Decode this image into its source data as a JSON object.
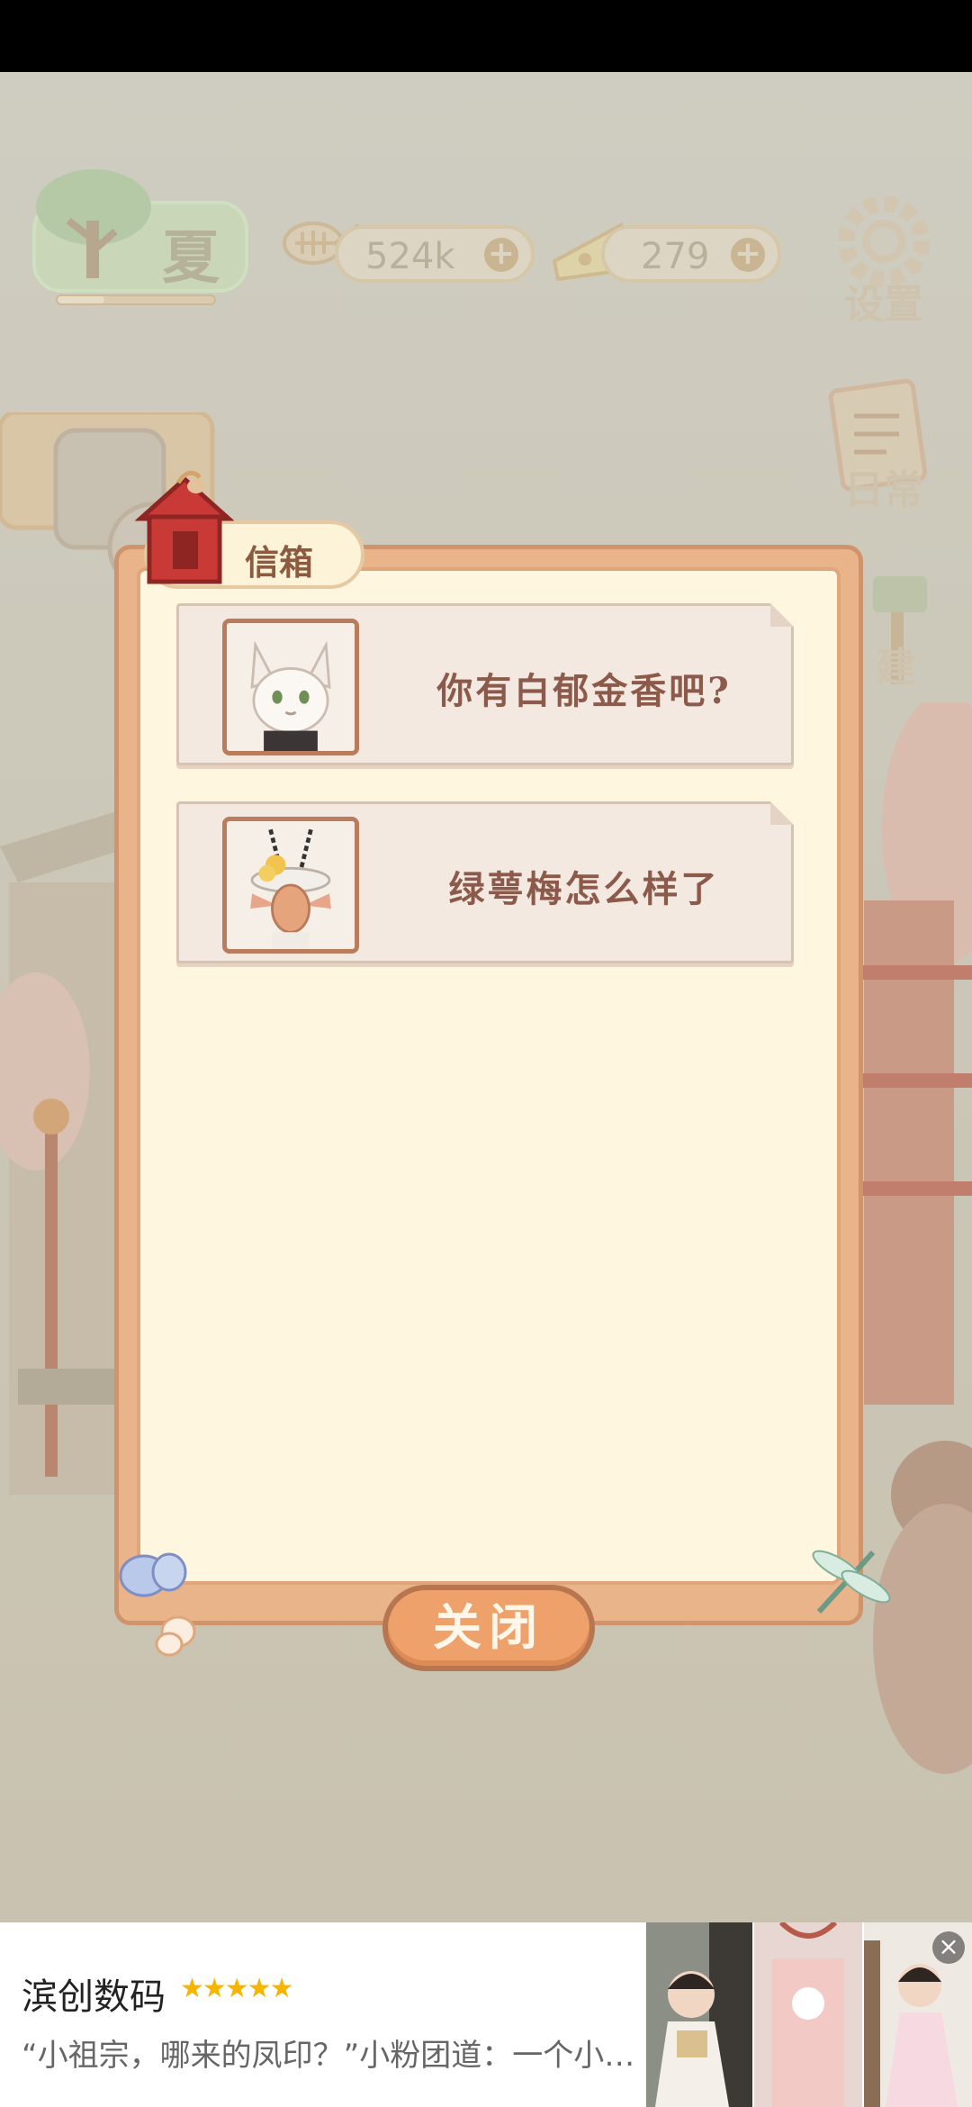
{
  "game": {
    "season_label": "夏",
    "season_progress": 0.3,
    "fish_amount": "524k",
    "cheese_amount": "279",
    "settings_label": "设置",
    "daily_label": "日常",
    "build_label": "建"
  },
  "dialog": {
    "tab_label": "信箱",
    "mails": [
      {
        "title": "你有白郁金香吧?",
        "avatar_icon": "fox-character-avatar"
      },
      {
        "title": "绿萼梅怎么样了",
        "avatar_icon": "antelope-character-avatar"
      }
    ],
    "close_label": "关闭"
  },
  "ad": {
    "title": "滨创数码",
    "stars": "★★★★★",
    "description": "“小祖宗，哪来的凤印？”小粉团道：一个小哥哥送的"
  },
  "colors": {
    "dialog_frame": "#e9b48a",
    "dialog_inner": "#fef6df",
    "close_button": "#eea16a",
    "title_text": "#8c5a4a"
  }
}
